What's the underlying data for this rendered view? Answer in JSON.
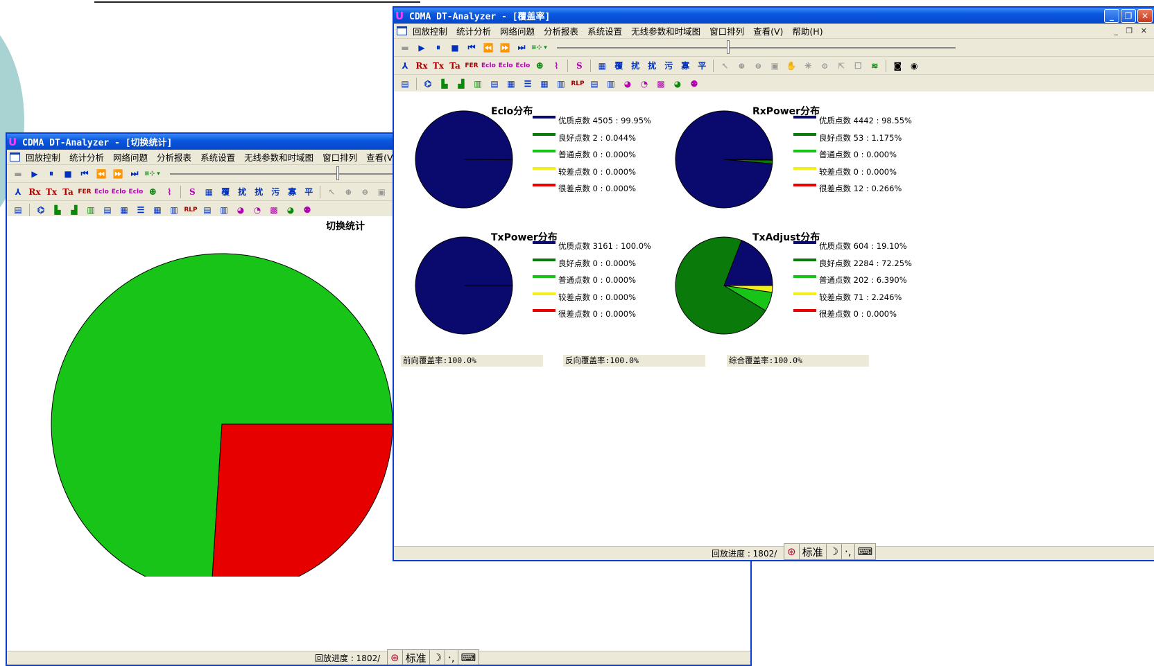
{
  "colors": {
    "excellent": "#0a0a6e",
    "good": "#0a7a0a",
    "normal": "#19c419",
    "poor": "#f4ef1a",
    "bad": "#e60000"
  },
  "left_window": {
    "app_icon": "U",
    "title": "CDMA DT-Analyzer - [切换统计]",
    "menu": [
      "回放控制",
      "统计分析",
      "网络问题",
      "分析报表",
      "系统设置",
      "无线参数和时域图",
      "窗口排列",
      "查看(V)"
    ],
    "chart_title": "切换统计",
    "status_progress": "回放进度 : 1802/",
    "ime_label": "标准"
  },
  "right_window": {
    "app_icon": "U",
    "title": "CDMA DT-Analyzer - [覆盖率]",
    "menu": [
      "回放控制",
      "统计分析",
      "网络问题",
      "分析报表",
      "系统设置",
      "无线参数和时域图",
      "窗口排列",
      "查看(V)",
      "帮助(H)"
    ],
    "coverage": {
      "forward": "前向覆盖率:100.0%",
      "reverse": "反向覆盖率:100.0%",
      "combined": "综合覆盖率:100.0%"
    },
    "status_progress": "回放进度 : 1802/",
    "ime_label": "标准"
  },
  "toolbar_icons": {
    "row1": [
      "folder-icon",
      "play-icon",
      "pause-icon",
      "stop-icon",
      "first-icon",
      "rewind-icon",
      "forward-icon",
      "last-icon",
      "speed-icon"
    ],
    "row2_text": [
      "Rx",
      "Tx",
      "Ta",
      "FER",
      "Eclo",
      "Eclo",
      "Eclo",
      "S",
      "覆",
      "扰",
      "扰",
      "污",
      "寡",
      "平"
    ]
  },
  "chart_data": [
    {
      "type": "pie",
      "title": "切换统计",
      "categories": [
        "",
        ""
      ],
      "values": [
        74,
        26
      ],
      "colors": [
        "#19c419",
        "#e60000"
      ]
    },
    {
      "type": "pie",
      "title": "Eclo分布",
      "categories": [
        "优质点数",
        "良好点数",
        "普通点数",
        "较差点数",
        "很差点数"
      ],
      "counts": [
        4505,
        2,
        0,
        0,
        0
      ],
      "labels": [
        "优质点数 4505 : 99.95%",
        "良好点数 2 : 0.044%",
        "普通点数 0 : 0.000%",
        "较差点数 0 : 0.000%",
        "很差点数 0 : 0.000%"
      ],
      "percents": [
        99.95,
        0.044,
        0.0,
        0.0,
        0.0
      ]
    },
    {
      "type": "pie",
      "title": "RxPower分布",
      "categories": [
        "优质点数",
        "良好点数",
        "普通点数",
        "较差点数",
        "很差点数"
      ],
      "counts": [
        4442,
        53,
        0,
        0,
        12
      ],
      "labels": [
        "优质点数 4442 : 98.55%",
        "良好点数 53 : 1.175%",
        "普通点数 0 : 0.000%",
        "较差点数 0 : 0.000%",
        "很差点数 12 : 0.266%"
      ],
      "percents": [
        98.55,
        1.175,
        0.0,
        0.0,
        0.266
      ]
    },
    {
      "type": "pie",
      "title": "TxPower分布",
      "categories": [
        "优质点数",
        "良好点数",
        "普通点数",
        "较差点数",
        "很差点数"
      ],
      "counts": [
        3161,
        0,
        0,
        0,
        0
      ],
      "labels": [
        "优质点数 3161 : 100.0%",
        "良好点数 0 : 0.000%",
        "普通点数 0 : 0.000%",
        "较差点数 0 : 0.000%",
        "很差点数 0 : 0.000%"
      ],
      "percents": [
        100.0,
        0.0,
        0.0,
        0.0,
        0.0
      ]
    },
    {
      "type": "pie",
      "title": "TxAdjust分布",
      "categories": [
        "优质点数",
        "良好点数",
        "普通点数",
        "较差点数",
        "很差点数"
      ],
      "counts": [
        604,
        2284,
        202,
        71,
        0
      ],
      "labels": [
        "优质点数 604 : 19.10%",
        "良好点数 2284 : 72.25%",
        "普通点数 202 : 6.390%",
        "较差点数 71 : 2.246%",
        "很差点数 0 : 0.000%"
      ],
      "percents": [
        19.1,
        72.25,
        6.39,
        2.246,
        0.0
      ]
    }
  ]
}
